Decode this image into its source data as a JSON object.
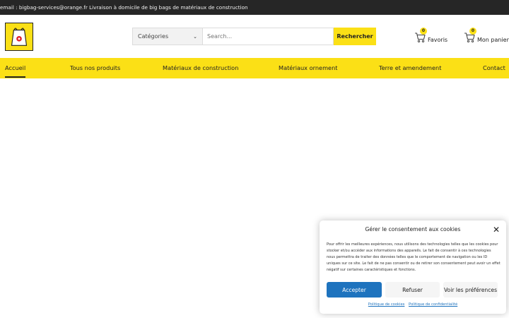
{
  "topbar": {
    "text": "email : bigbag-services@orange.fr Livraison à domicile de big bags de matériaux de construction"
  },
  "header": {
    "logo_alt": "big bag logo",
    "search": {
      "category_label": "Catégories",
      "placeholder": "Search...",
      "button_label": "Rechercher"
    },
    "favorites": {
      "count": "0",
      "label": "Favoris"
    },
    "cart": {
      "count": "0",
      "label": "Mon panier"
    }
  },
  "nav": {
    "items": [
      {
        "label": "Accueil",
        "active": true
      },
      {
        "label": "Tous nos produits"
      },
      {
        "label": "Matériaux de construction"
      },
      {
        "label": "Matériaux ornement"
      },
      {
        "label": "Terre et amendement"
      },
      {
        "label": "Contact"
      }
    ]
  },
  "consent": {
    "title": "Gérer le consentement aux cookies",
    "body": "Pour offrir les meilleures expériences, nous utilisons des technologies telles que les cookies pour stocker et/ou accéder aux informations des appareils. Le fait de consentir à ces technologies nous permettra de traiter des données telles que le comportement de navigation ou les ID uniques sur ce site. Le fait de ne pas consentir ou de retirer son consentement peut avoir un effet négatif sur certaines caractéristiques et fonctions.",
    "accept_label": "Accepter",
    "refuse_label": "Refuser",
    "prefs_label": "Voir les préférences",
    "cookie_policy_label": "Politique de cookies",
    "privacy_policy_label": "Politique de confidentialité"
  },
  "colors": {
    "accent": "#fbe016",
    "topbar_bg": "#262626",
    "primary_button": "#1e73be"
  },
  "icons": {
    "favorites": "cart-icon",
    "cart": "cart-icon",
    "close": "close-icon",
    "category_chevron": "chevron-down-icon"
  }
}
